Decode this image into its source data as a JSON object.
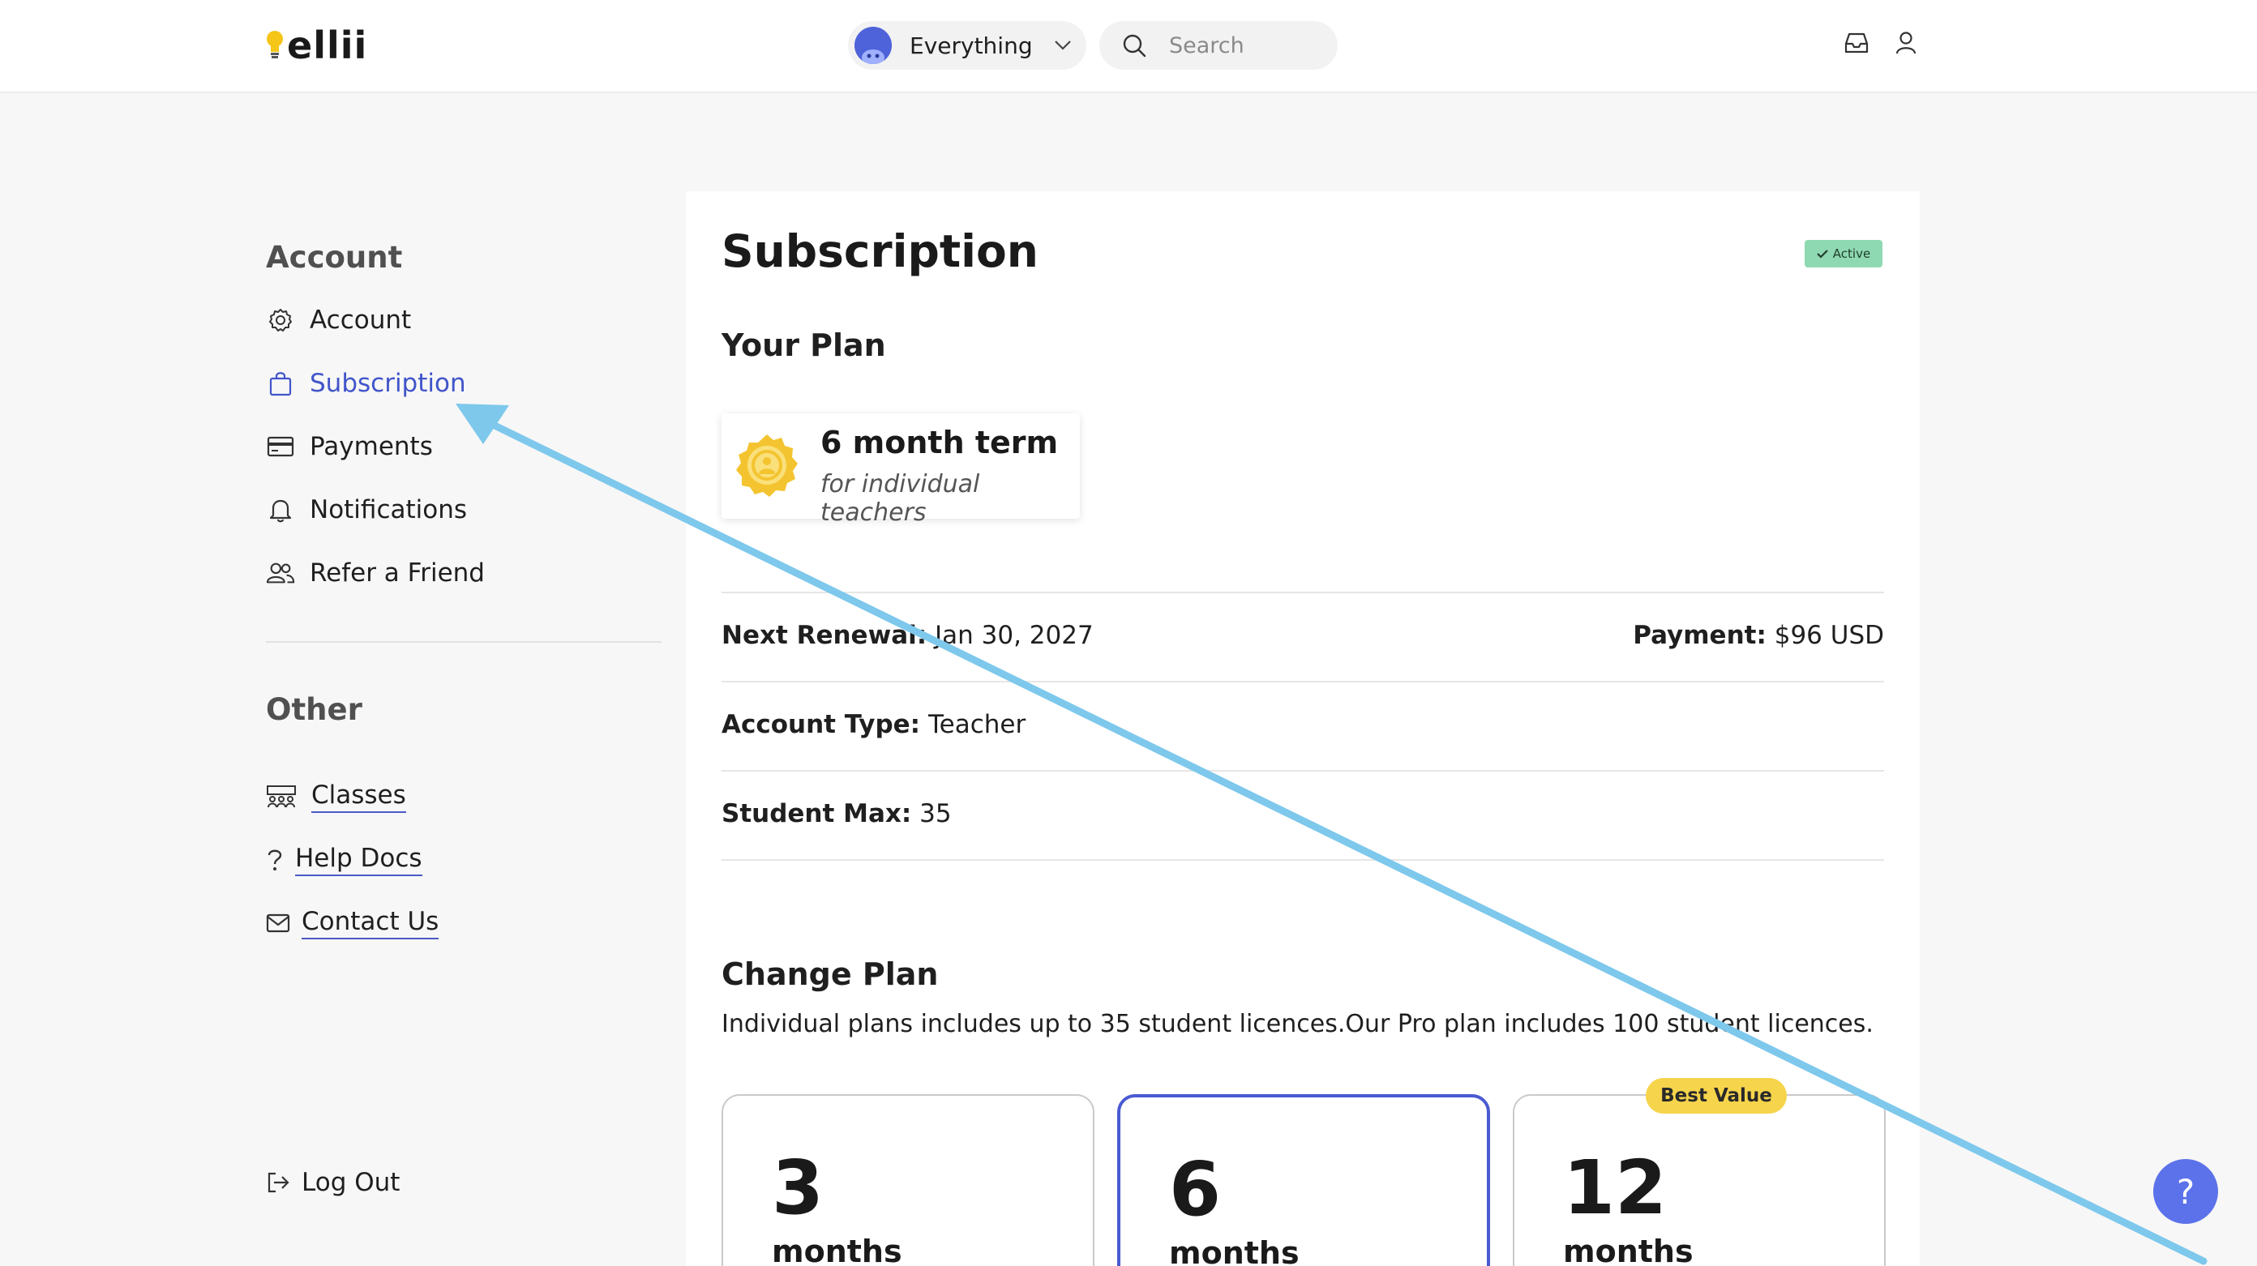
{
  "header": {
    "logo_text": "ellii",
    "scope_label": "Everything",
    "search_placeholder": "Search"
  },
  "sidebar": {
    "account_title": "Account",
    "account_items": [
      {
        "label": "Account",
        "icon": "gear-icon"
      },
      {
        "label": "Subscription",
        "icon": "shopping-bag-icon",
        "active": true
      },
      {
        "label": "Payments",
        "icon": "credit-card-icon"
      },
      {
        "label": "Notifications",
        "icon": "bell-icon"
      },
      {
        "label": "Refer a Friend",
        "icon": "users-icon"
      }
    ],
    "other_title": "Other",
    "other_items": [
      {
        "label": "Classes",
        "icon": "classroom-icon"
      },
      {
        "label": "Help Docs",
        "icon": "question-icon"
      },
      {
        "label": "Contact Us",
        "icon": "envelope-icon"
      }
    ],
    "logout_label": "Log Out"
  },
  "main": {
    "title": "Subscription",
    "status_badge": "Active",
    "your_plan_heading": "Your Plan",
    "plan": {
      "term": "6 month term",
      "audience": "for individual teachers"
    },
    "next_renewal_label": "Next Renewal:",
    "next_renewal_value": "Jan 30, 2027",
    "payment_label": "Payment:",
    "payment_value": "$96 USD",
    "account_type_label": "Account Type:",
    "account_type_value": "Teacher",
    "student_max_label": "Student Max:",
    "student_max_value": "35",
    "change_plan_heading": "Change Plan",
    "change_plan_desc": "Individual plans includes up to 35 student licences.Our Pro plan includes 100 student licences.",
    "options": [
      {
        "number": "3",
        "unit": "months"
      },
      {
        "number": "6",
        "unit": "months",
        "selected": true
      },
      {
        "number": "12",
        "unit": "months",
        "tag": "Best Value"
      }
    ]
  },
  "help_button_glyph": "?",
  "colors": {
    "accent": "#4155c9",
    "active_badge": "#8fd9b2",
    "best_value_tag": "#f6d44b",
    "annotation_arrow": "#7ec8ec"
  }
}
